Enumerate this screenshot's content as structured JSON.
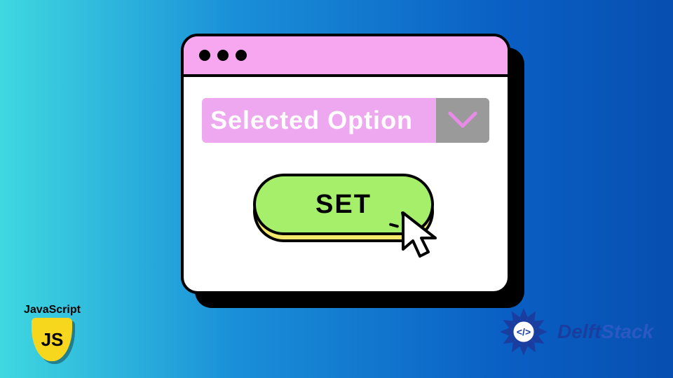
{
  "dropdown": {
    "label": "Selected Option"
  },
  "button": {
    "label": "SET"
  },
  "badges": {
    "js_top": "JavaScript",
    "js_shield": "JS",
    "delft_prefix": "Delft",
    "delft_suffix": "Stack"
  }
}
